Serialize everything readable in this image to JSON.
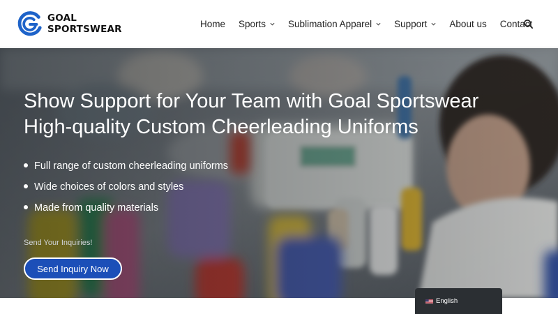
{
  "brand": {
    "line1": "GOAL",
    "line2": "SPORTSWEAR",
    "logo_icon": "goal-g-logo",
    "colors": {
      "blue": "#1e63c9",
      "dark": "#111111"
    }
  },
  "nav": {
    "items": [
      {
        "label": "Home",
        "has_dropdown": false
      },
      {
        "label": "Sports",
        "has_dropdown": true
      },
      {
        "label": "Sublimation Apparel",
        "has_dropdown": true
      },
      {
        "label": "Support",
        "has_dropdown": true
      },
      {
        "label": "About us",
        "has_dropdown": false
      },
      {
        "label": "Contact",
        "has_dropdown": false
      }
    ],
    "search_icon": "search-icon"
  },
  "hero": {
    "title_line1": "Show Support for Your Team with Goal Sportswear",
    "title_line2": "High-quality Custom Cheerleading Uniforms",
    "bullets": [
      "Full range of custom cheerleading uniforms",
      "Wide choices of colors and styles",
      "Made from quality materials"
    ],
    "inquiry_note": "Send Your Inquiries!",
    "cta_label": "Send Inquiry Now",
    "cta_color": "#1c4fb8"
  },
  "language": {
    "label": "English",
    "flag_icon": "us-flag-icon"
  }
}
